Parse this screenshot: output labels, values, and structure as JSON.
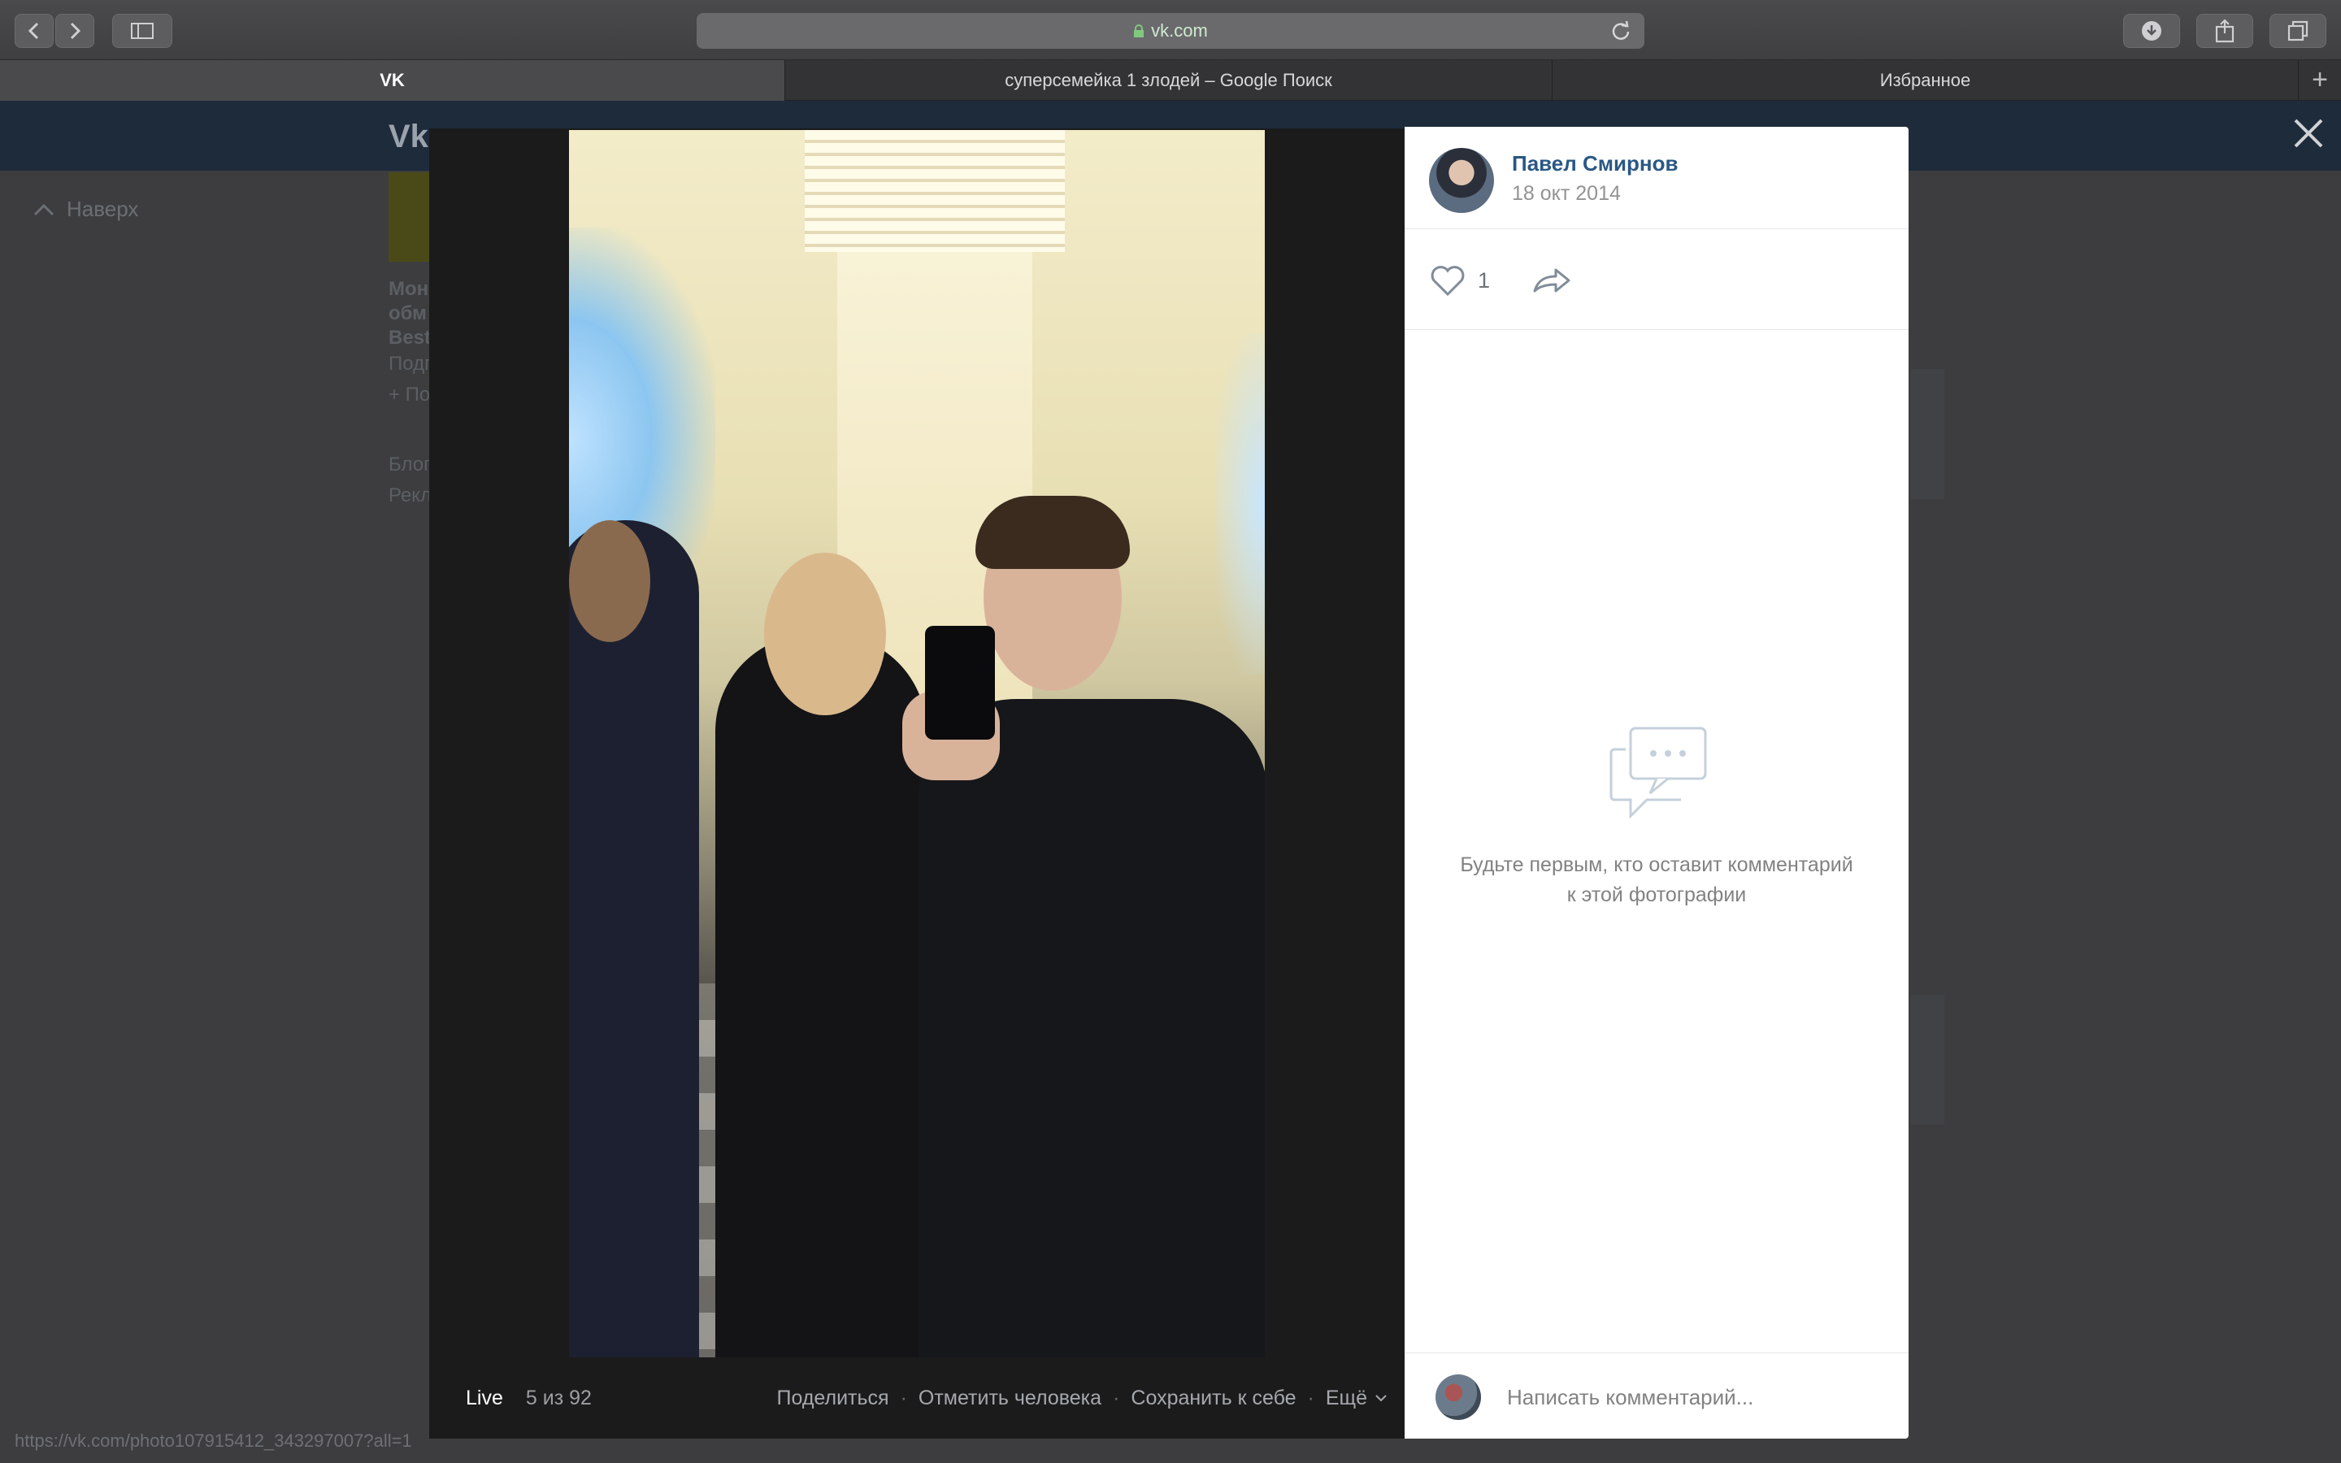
{
  "browser": {
    "url": "vk.com",
    "tabs": [
      {
        "label": "VK",
        "active": true
      },
      {
        "label": "суперсемейка 1 злодей – Google Поиск",
        "active": false
      },
      {
        "label": "Избранное",
        "active": false
      }
    ],
    "status_url": "https://vk.com/photo107915412_343297007?all=1"
  },
  "vk": {
    "logo": "Vk",
    "scroll_up": "Наверх",
    "ghost_lines": [
      "Мон",
      "обм",
      "Best",
      "Подп",
      "+ По",
      "Блог",
      "Рекл"
    ]
  },
  "viewer": {
    "live_label": "Live",
    "counter": "5 из 92",
    "actions": [
      "Поделиться",
      "Отметить человека",
      "Сохранить к себе",
      "Ещё"
    ]
  },
  "panel": {
    "author_name": "Павел Смирнов",
    "date": "18 окт 2014",
    "likes": "1",
    "empty_text": "Будьте первым, кто оставит комментарий к этой фотографии",
    "comment_placeholder": "Написать комментарий..."
  },
  "colors": {
    "link": "#2a5885",
    "header": "#1e2b3b",
    "secure_url": "#cfe9cf"
  }
}
